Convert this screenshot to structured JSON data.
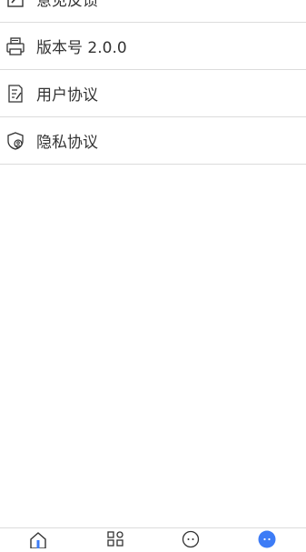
{
  "settings_menu": [
    {
      "label": "意见反馈",
      "icon": "edit-icon"
    },
    {
      "label": "版本号 2.0.0",
      "icon": "printer-icon"
    },
    {
      "label": "用户协议",
      "icon": "document-edit-icon"
    },
    {
      "label": "隐私协议",
      "icon": "privacy-shield-icon"
    }
  ],
  "tabbar": {
    "tabs": [
      {
        "icon": "home-icon"
      },
      {
        "icon": "apps-grid-icon"
      },
      {
        "icon": "chat-icon"
      },
      {
        "icon": "profile-icon",
        "active": true
      }
    ]
  },
  "colors": {
    "accent": "#3d7cf6",
    "text": "#333333",
    "divider": "#dcdcdc"
  }
}
